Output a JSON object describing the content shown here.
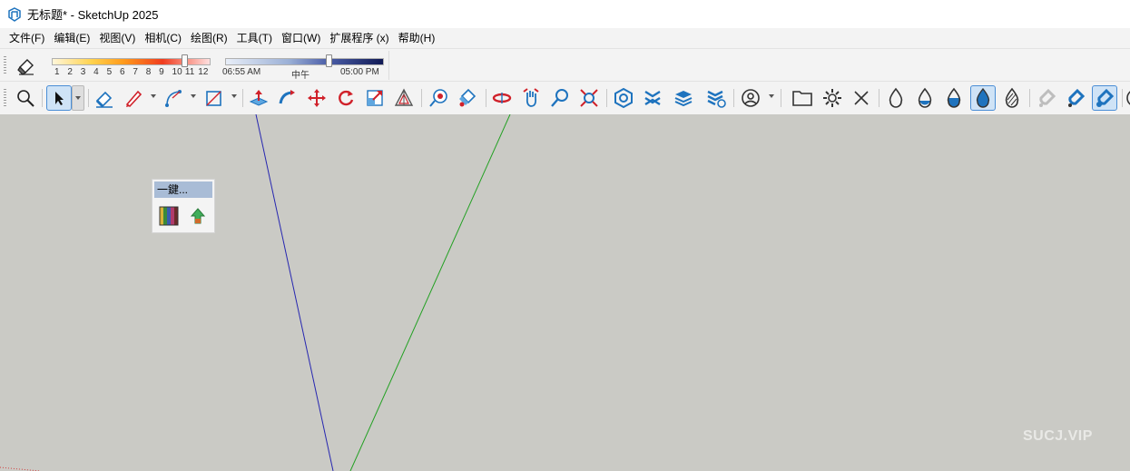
{
  "window": {
    "title": "无标题* - SketchUp 2025"
  },
  "menu": [
    "文件(F)",
    "编辑(E)",
    "视图(V)",
    "相机(C)",
    "绘图(R)",
    "工具(T)",
    "窗口(W)",
    "扩展程序 (x)",
    "帮助(H)"
  ],
  "shadows": {
    "months": [
      "1",
      "2",
      "3",
      "4",
      "5",
      "6",
      "7",
      "8",
      "9",
      "10",
      "11",
      "12"
    ],
    "month_value": 11,
    "time_start": "06:55 AM",
    "time_noon": "中午",
    "time_end": "05:00 PM"
  },
  "toolbar": {
    "tools": [
      "zoom-extents-icon",
      "select-icon",
      "eraser-icon",
      "pencil-icon",
      "arc-icon",
      "rectangle-icon",
      "push-pull-icon",
      "follow-me-icon",
      "move-icon",
      "rotate-icon",
      "scale-icon",
      "offset-icon",
      "tape-measure-icon",
      "paint-bucket-icon",
      "orbit-icon",
      "pan-icon",
      "zoom-icon",
      "zoom-window-icon",
      "warehouse-icon",
      "extension-warehouse-icon",
      "layers-icon",
      "components-icon",
      "profile-icon",
      "folder-icon",
      "settings-icon",
      "close-icon",
      "drop-empty-icon",
      "drop-low-icon",
      "drop-half-icon",
      "drop-full-icon",
      "drop-hatched-icon",
      "magnet-off-icon",
      "magnet-icon",
      "magnet-on-icon"
    ]
  },
  "plugin_panel": {
    "title": "一鍵..."
  },
  "watermark": "SUCJ.VIP",
  "colors": {
    "viewport": "#cacac5",
    "blue_axis": "#2626b0",
    "green_axis": "#22a022",
    "accent": "#1e73be"
  }
}
